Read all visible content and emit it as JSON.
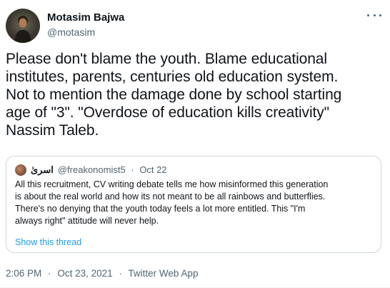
{
  "author": {
    "display_name": "Motasim Bajwa",
    "handle": "@motasim"
  },
  "tweet": {
    "text": "Please don't blame the youth. Blame educational\ninstitutes, parents,  centuries old education system.\nNot to mention the damage  done by school starting\nage of \"3\". \"Overdose of education kills creativity\"\nNassim Taleb."
  },
  "quote": {
    "display_name": "اسریٰ",
    "handle": "@freakonomist5",
    "separator": "·",
    "date": "Oct 22",
    "text": "All this recruitment, CV writing debate tells me how misinformed this generation\nis about the real world and how its not meant to be all rainbows and butterflies.\nThere's no denying that the youth today feels a lot more entitled. This \"I'm\nalways right\" attitude will never help.",
    "show_thread_label": "Show this thread"
  },
  "meta": {
    "time": "2:06 PM",
    "separator": "·",
    "date": "Oct 23, 2021",
    "source": "Twitter Web App"
  },
  "icons": {
    "more": "more-horizontal-icon"
  }
}
